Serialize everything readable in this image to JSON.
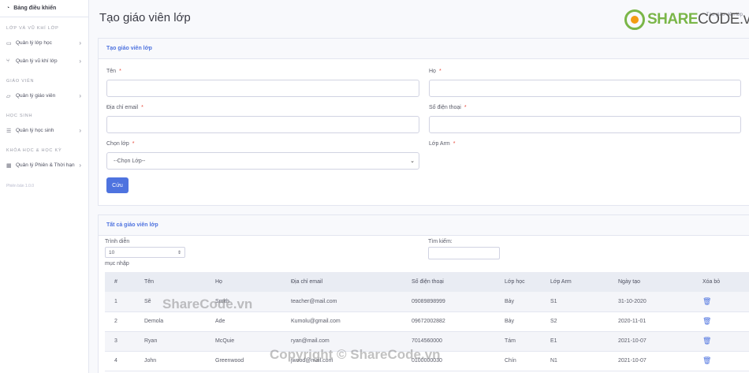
{
  "sidebar": {
    "dashboard": "Bảng điều khiển",
    "sections": [
      {
        "heading": "LỚP VÀ VŨ KHÍ LỚP",
        "items": [
          "Quản lý lớp học",
          "Quản lý vũ khí lớp"
        ]
      },
      {
        "heading": "GIÁO VIÊN",
        "items": [
          "Quản lý giáo viên"
        ]
      },
      {
        "heading": "HỌC SINH",
        "items": [
          "Quản lý học sinh"
        ]
      },
      {
        "heading": "KHÓA HỌC & HỌC KỲ",
        "items": [
          "Quản lý Phiên & Thời hạn"
        ]
      }
    ],
    "version": "Phiên bản 1.0.0"
  },
  "page": {
    "title": "Tạo giáo viên lớp",
    "breadcrumb": "Tạo giáo viên lớp",
    "logo_share": "SHARE",
    "logo_code": "CODE.vn"
  },
  "form": {
    "heading": "Tạo giáo viên lớp",
    "first_name_label": "Tên",
    "last_name_label": "Họ",
    "email_label": "Địa chỉ email",
    "phone_label": "Số điện thoại",
    "class_label": "Chọn lớp",
    "class_arm_label": "Lớp Arm",
    "class_select_value": "--Chọn Lớp--",
    "required_mark": "*",
    "save_label": "Cứu"
  },
  "list": {
    "heading": "Tất cả giáo viên lớp",
    "show_label": "Trình diễn",
    "show_value": "10",
    "entries_label": "mục nhập",
    "search_label": "Tìm kiếm:",
    "columns": [
      "#",
      "Tên",
      "Họ",
      "Địa chỉ email",
      "Số điện thoại",
      "Lớp học",
      "Lớp Arm",
      "Ngày tạo",
      "Xóa bỏ"
    ],
    "rows": [
      [
        "1",
        "Sẽ",
        "Smith",
        "teacher@mail.com",
        "09089898999",
        "Bảy",
        "S1",
        "31-10-2020"
      ],
      [
        "2",
        "Demola",
        "Ade",
        "Kumolu@gmail.com",
        "09672002882",
        "Bảy",
        "S2",
        "2020-11-01"
      ],
      [
        "3",
        "Ryan",
        "McQuie",
        "ryan@mail.com",
        "7014560000",
        "Tám",
        "E1",
        "2021-10-07"
      ],
      [
        "4",
        "John",
        "Greenwood",
        "jwood@mail.com",
        "0100000030",
        "Chín",
        "N1",
        "2021-10-07"
      ]
    ]
  },
  "watermarks": [
    "ShareCode.vn",
    "Copyright © ShareCode.vn"
  ]
}
